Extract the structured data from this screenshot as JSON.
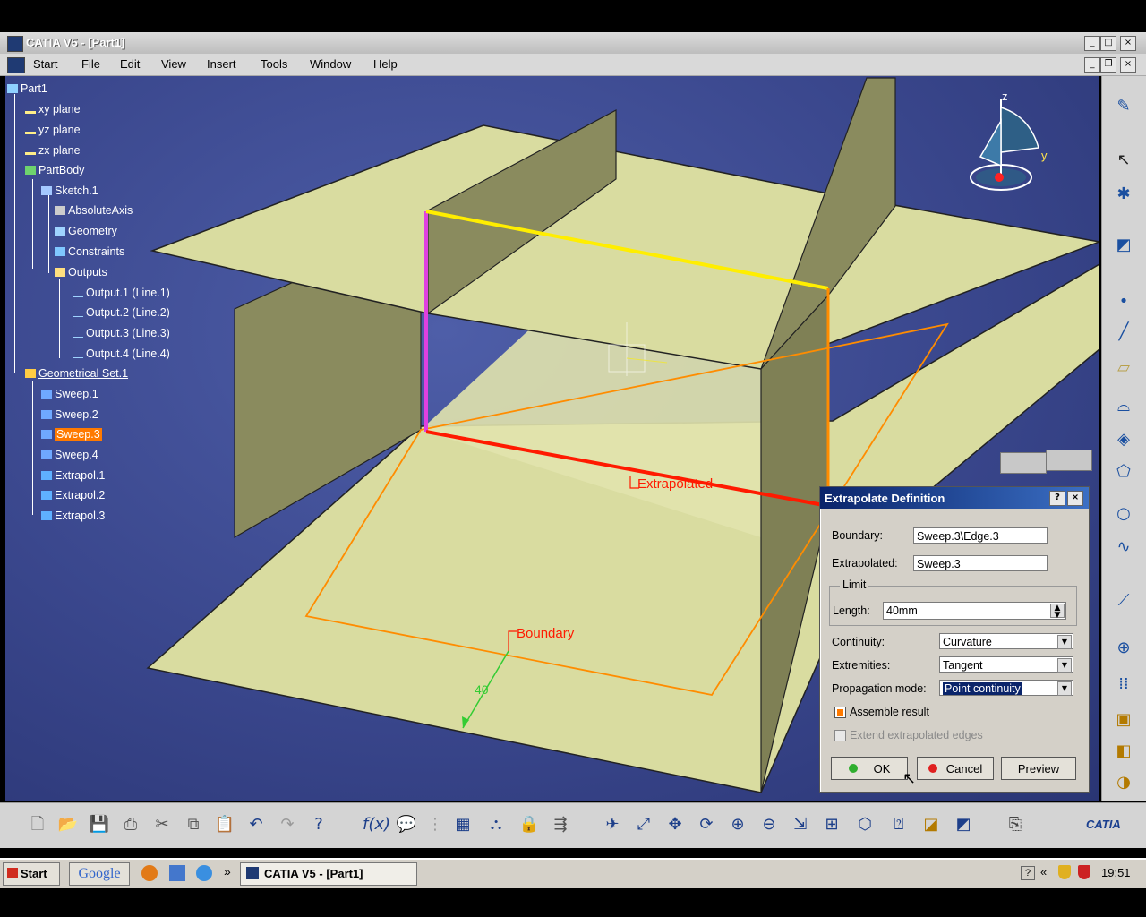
{
  "window": {
    "title": "CATIA V5 - [Part1]"
  },
  "menu": [
    "Start",
    "File",
    "Edit",
    "View",
    "Insert",
    "Tools",
    "Window",
    "Help"
  ],
  "tree": {
    "root": "Part1",
    "items": [
      {
        "label": "xy plane"
      },
      {
        "label": "yz plane"
      },
      {
        "label": "zx plane"
      },
      {
        "label": "PartBody"
      },
      {
        "label": "Sketch.1"
      },
      {
        "label": "AbsoluteAxis"
      },
      {
        "label": "Geometry"
      },
      {
        "label": "Constraints"
      },
      {
        "label": "Outputs"
      },
      {
        "label": "Output.1 (Line.1)"
      },
      {
        "label": "Output.2 (Line.2)"
      },
      {
        "label": "Output.3 (Line.3)"
      },
      {
        "label": "Output.4 (Line.4)"
      },
      {
        "label": "Geometrical Set.1"
      },
      {
        "label": "Sweep.1"
      },
      {
        "label": "Sweep.2"
      },
      {
        "label": "Sweep.3"
      },
      {
        "label": "Sweep.4"
      },
      {
        "label": "Extrapol.1"
      },
      {
        "label": "Extrapol.2"
      },
      {
        "label": "Extrapol.3"
      }
    ]
  },
  "viewport": {
    "label_extrapolated": "Extrapolated",
    "label_boundary": "Boundary",
    "dimension_value": "40",
    "compass_z": "z",
    "compass_y": "y"
  },
  "dialog": {
    "title": "Extrapolate Definition",
    "help": "?",
    "close": "×",
    "boundary_label": "Boundary:",
    "boundary_value": "Sweep.3\\Edge.3",
    "extrapolated_label": "Extrapolated:",
    "extrapolated_value": "Sweep.3",
    "limit_group": "Limit",
    "length_label": "Length:",
    "length_value": "40mm",
    "continuity_label": "Continuity:",
    "continuity_value": "Curvature",
    "extremities_label": "Extremities:",
    "extremities_value": "Tangent",
    "propagation_label": "Propagation mode:",
    "propagation_value": "Point continuity",
    "assemble_label": "Assemble result",
    "assemble_checked": true,
    "extend_label": "Extend extrapolated edges",
    "extend_checked": false,
    "ok": "OK",
    "cancel": "Cancel",
    "preview": "Preview"
  },
  "taskbar": {
    "start": "Start",
    "google": "Google",
    "chevron": "»",
    "task": "CATIA V5 - [Part1]",
    "tray_chevron": "«",
    "clock": "19:51"
  },
  "brand": "CATIA",
  "colors": {
    "viewport_bg": "#3a478d",
    "surface": "#d9dca0",
    "surface_shadow": "#8a8b5e",
    "selection": "#ff7a00",
    "yellow_edge": "#ffee00",
    "magenta_edge": "#e040e0",
    "red_edge": "#ff1a00",
    "orange_edge": "#ff8c00",
    "dimension": "#33cc33"
  },
  "icons": {
    "right_toolbar": [
      "sketcher-icon",
      "select-arrow-icon",
      "snap-icon",
      "sketch-icon",
      "point-icon",
      "line-icon",
      "plane-icon",
      "extrude-icon",
      "sweep-icon",
      "fill-icon",
      "circle-icon",
      "spline-icon",
      "curve-icon",
      "join-icon",
      "pattern-icon",
      "repeat-icon",
      "part-design-icon",
      "analysis-icon"
    ],
    "bottom_toolbar": [
      "new-icon",
      "open-icon",
      "save-icon",
      "print-icon",
      "cut-icon",
      "copy-icon",
      "paste-icon",
      "undo-icon",
      "redo-icon",
      "whats-this-icon",
      "formula-icon",
      "comment-icon",
      "knowledge-icon",
      "table-icon",
      "catalog-icon",
      "lock-icon",
      "instantiate-icon",
      "fly-icon",
      "fit-all-icon",
      "pan-icon",
      "rotate-icon",
      "zoom-in-icon",
      "zoom-out-icon",
      "normal-view-icon",
      "multi-view-icon",
      "iso-view-icon",
      "render-style-icon",
      "hide-show-icon",
      "swap-visible-icon",
      "material-icon"
    ]
  }
}
